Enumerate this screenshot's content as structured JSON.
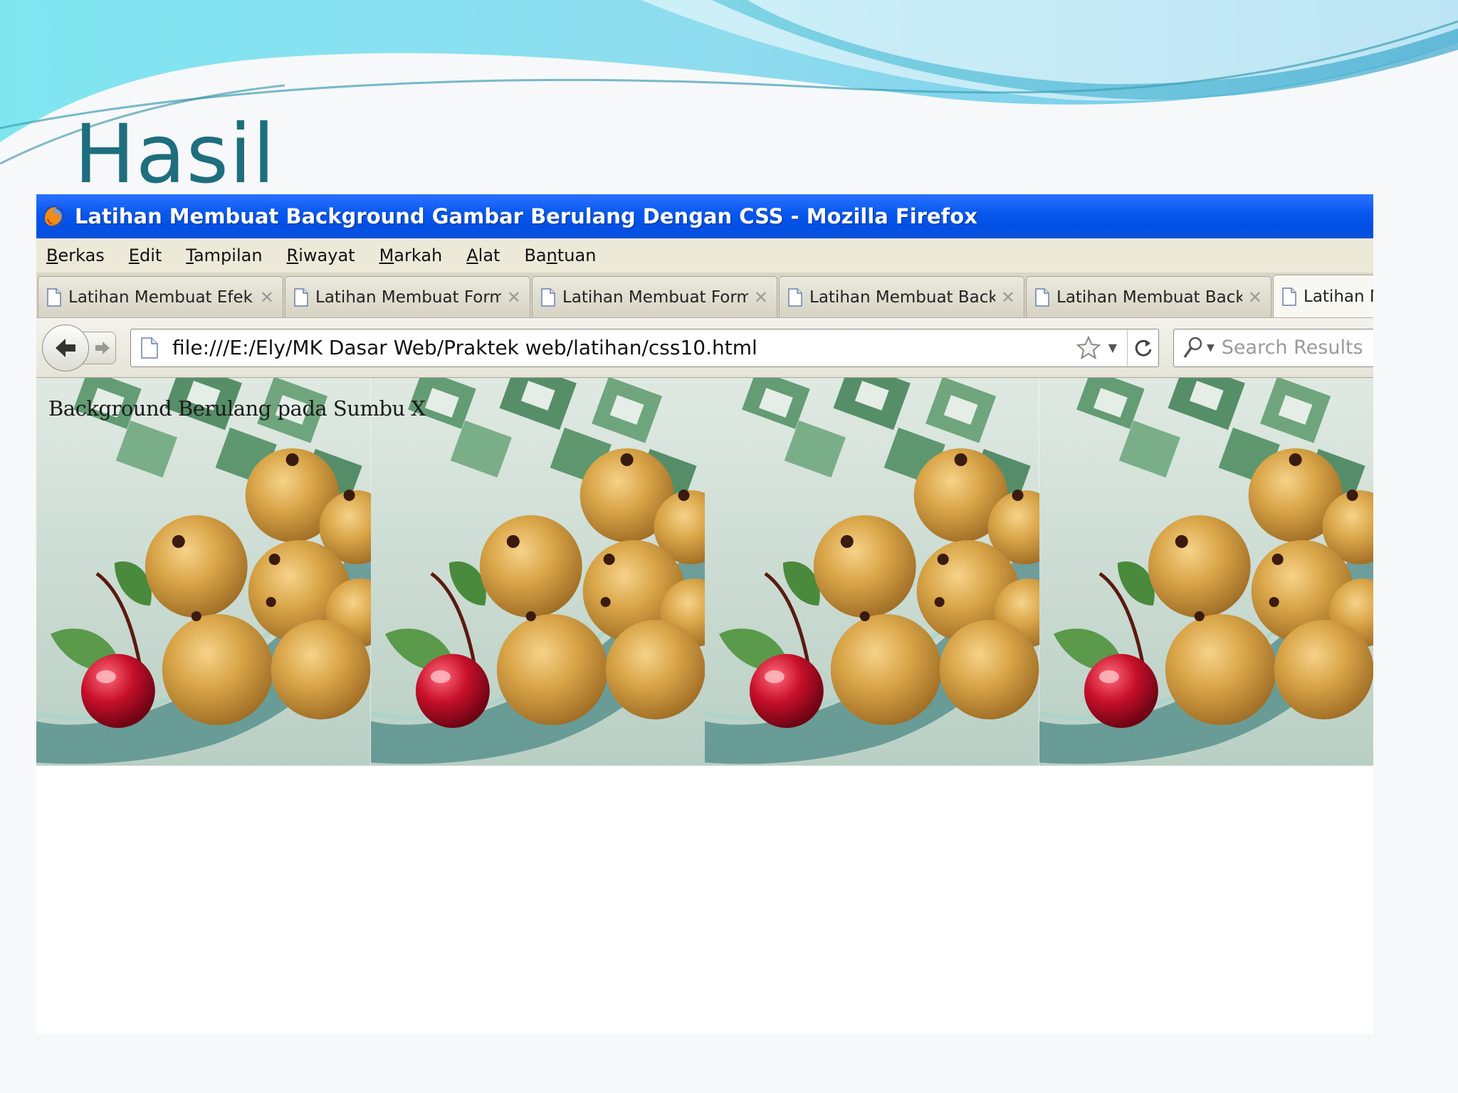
{
  "slide": {
    "title": "Hasil"
  },
  "window": {
    "title": "Latihan Membuat Background Gambar Berulang Dengan CSS - Mozilla Firefox"
  },
  "menubar": {
    "items": [
      {
        "accel": "B",
        "rest": "erkas"
      },
      {
        "accel": "E",
        "rest": "dit"
      },
      {
        "accel": "T",
        "rest": "ampilan"
      },
      {
        "accel": "R",
        "rest": "iwayat"
      },
      {
        "accel": "M",
        "rest": "arkah"
      },
      {
        "accel": "A",
        "rest": "lat"
      },
      {
        "pre": "Ba",
        "accel": "n",
        "rest": "tuan"
      }
    ]
  },
  "tabs": [
    {
      "label": "Latihan Membuat Efek ..."
    },
    {
      "label": "Latihan Membuat Form..."
    },
    {
      "label": "Latihan Membuat Form..."
    },
    {
      "label": "Latihan Membuat Back..."
    },
    {
      "label": "Latihan Membuat Back..."
    },
    {
      "label": "Latihan M"
    }
  ],
  "navbar": {
    "url": "file:///E:/Ely/MK Dasar Web/Praktek web/latihan/css10.html",
    "search_placeholder": "Search Results"
  },
  "page": {
    "text": "Background Berulang pada Sumbu X"
  },
  "colors": {
    "title": "#1e6e7e",
    "titlebar": "#0a5af0",
    "menubar": "#ece9d8"
  }
}
